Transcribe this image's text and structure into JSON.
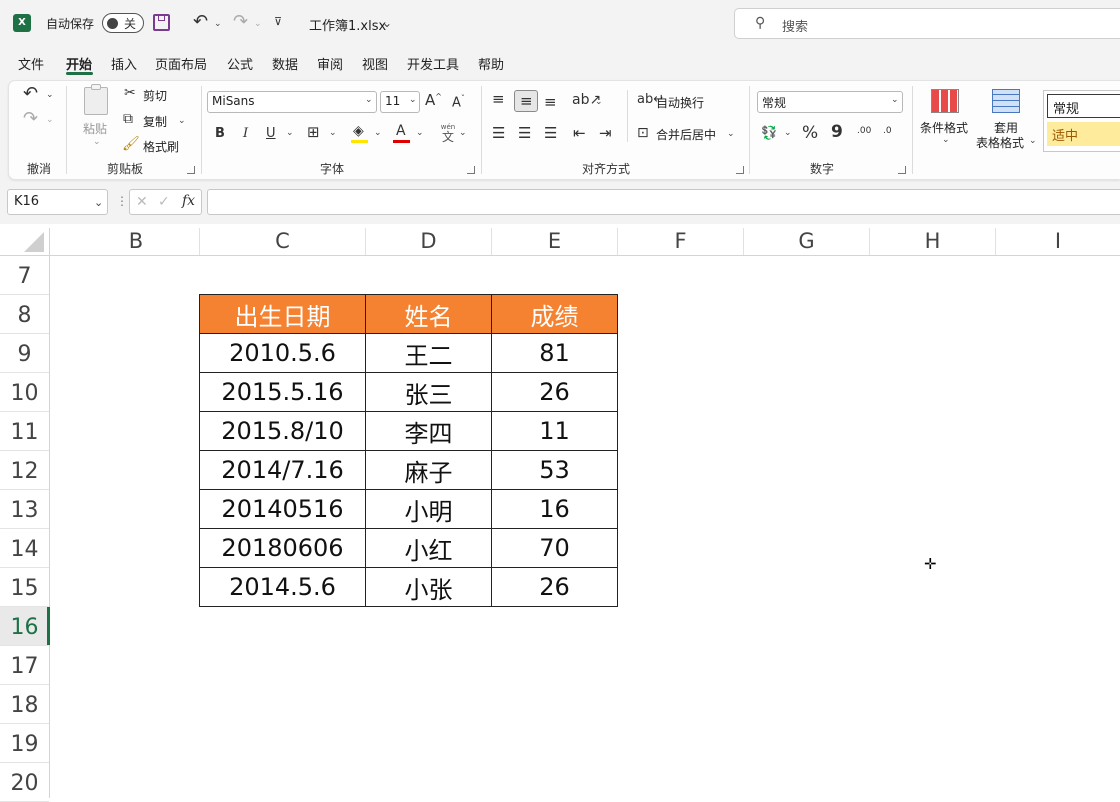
{
  "titlebar": {
    "autosave_label": "自动保存",
    "autosave_state": "关",
    "filename": "工作簿1.xlsx",
    "search_placeholder": "搜索"
  },
  "menu": [
    "文件",
    "开始",
    "插入",
    "页面布局",
    "公式",
    "数据",
    "审阅",
    "视图",
    "开发工具",
    "帮助"
  ],
  "menu_active": "开始",
  "ribbon": {
    "undo_group": "撤消",
    "clipboard": {
      "paste": "粘贴",
      "cut": "剪切",
      "copy": "复制",
      "painter": "格式刷",
      "label": "剪贴板"
    },
    "font": {
      "name": "MiSans",
      "size": "11",
      "bold": "B",
      "italic": "I",
      "underline": "U",
      "label": "字体",
      "phonetic_top": "wén",
      "phonetic_bottom": "文"
    },
    "alignment": {
      "wrap": "自动换行",
      "merge": "合并后居中",
      "label": "对齐方式"
    },
    "number": {
      "format": "常规",
      "percent": "%",
      "comma": "9",
      "inc_dec": ".00",
      "dec_dec": ".0",
      "label": "数字"
    },
    "styles": {
      "conditional": "条件格式",
      "table_line1": "套用",
      "table_line2": "表格格式",
      "style_normal": "常规",
      "style_neutral": "适中"
    }
  },
  "formula_bar": {
    "name_box": "K16",
    "fx": "fx"
  },
  "columns": [
    "B",
    "C",
    "D",
    "E",
    "F",
    "G",
    "H",
    "I"
  ],
  "rows": [
    "7",
    "8",
    "9",
    "10",
    "11",
    "12",
    "13",
    "14",
    "15",
    "16",
    "17",
    "18",
    "19",
    "20"
  ],
  "active_row": "16",
  "colors": {
    "header_fill": "#f48230",
    "header_text": "#ffffff",
    "excel_green": "#1e7145",
    "save_icon": "#7a3b8f",
    "font_color_bar": "#e00000",
    "highlight_bar": "#ffe500"
  },
  "table": {
    "headers": [
      "出生日期",
      "姓名",
      "成绩"
    ],
    "rows": [
      [
        "2010.5.6",
        "王二",
        "81"
      ],
      [
        "2015.5.16",
        "张三",
        "26"
      ],
      [
        "2015.8/10",
        "李四",
        "11"
      ],
      [
        "2014/7.16",
        "麻子",
        "53"
      ],
      [
        "20140516",
        "小明",
        "16"
      ],
      [
        "20180606",
        "小红",
        "70"
      ],
      [
        "2014.5.6",
        "小张",
        "26"
      ]
    ]
  }
}
